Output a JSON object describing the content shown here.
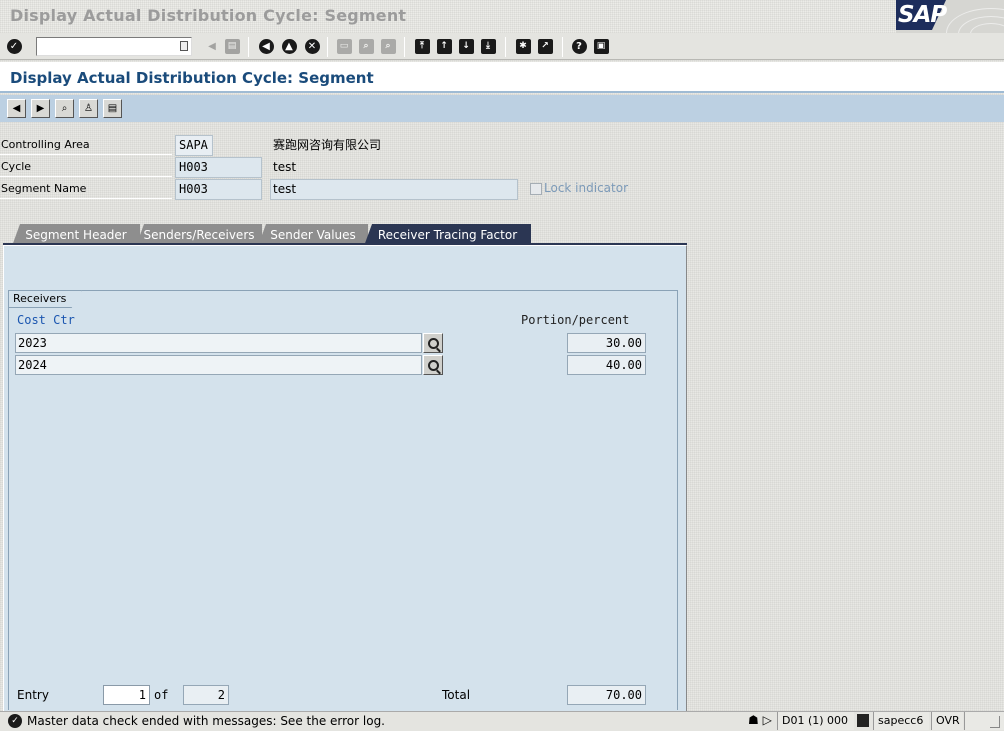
{
  "window": {
    "title": "Display Actual Distribution Cycle: Segment",
    "logo_text": "SAP"
  },
  "toolbar": {
    "command_field_value": "",
    "buttons": [
      {
        "name": "enter-icon",
        "glyph": "✓"
      },
      {
        "name": "back-arrow-icon",
        "glyph": "◀"
      },
      {
        "name": "save-icon",
        "glyph": "▤"
      },
      {
        "name": "back-icon",
        "glyph": "◀"
      },
      {
        "name": "exit-icon",
        "glyph": "▲"
      },
      {
        "name": "cancel-icon",
        "glyph": "✕"
      },
      {
        "name": "print-icon",
        "glyph": "▭"
      },
      {
        "name": "find-icon",
        "glyph": "⌕"
      },
      {
        "name": "find-next-icon",
        "glyph": "⌕"
      },
      {
        "name": "first-page-icon",
        "glyph": "⤒"
      },
      {
        "name": "previous-page-icon",
        "glyph": "↑"
      },
      {
        "name": "next-page-icon",
        "glyph": "↓"
      },
      {
        "name": "last-page-icon",
        "glyph": "⤓"
      },
      {
        "name": "new-session-icon",
        "glyph": "✱"
      },
      {
        "name": "shortcut-icon",
        "glyph": "↗"
      },
      {
        "name": "help-icon",
        "glyph": "?"
      },
      {
        "name": "layout-menu-icon",
        "glyph": "▣"
      }
    ]
  },
  "screen": {
    "title": "Display Actual Distribution Cycle: Segment"
  },
  "app_toolbar": {
    "buttons": [
      {
        "name": "previous-segment-icon",
        "glyph": "◀"
      },
      {
        "name": "next-segment-icon",
        "glyph": "▶"
      },
      {
        "name": "binoculars-icon",
        "glyph": "⌕"
      },
      {
        "name": "user-icon",
        "glyph": "♙"
      },
      {
        "name": "print-preview-icon",
        "glyph": "▤"
      }
    ]
  },
  "header": {
    "controlling_area": {
      "label": "Controlling Area",
      "value": "SAPA",
      "text": "赛跑网咨询有限公司"
    },
    "cycle": {
      "label": "Cycle",
      "value": "H003",
      "text": "test"
    },
    "segment": {
      "label": "Segment Name",
      "value": "H003",
      "text": "test"
    },
    "lock_indicator": {
      "label": "Lock indicator",
      "checked": false
    }
  },
  "tabs": [
    {
      "label": "Segment Header",
      "active": false
    },
    {
      "label": "Senders/Receivers",
      "active": false
    },
    {
      "label": "Sender Values",
      "active": false
    },
    {
      "label": "Receiver Tracing Factor",
      "active": true
    }
  ],
  "receivers": {
    "group_title": "Receivers",
    "col_cost_ctr": "Cost Ctr",
    "col_portion": "Portion/percent",
    "rows": [
      {
        "cost_ctr": "2023",
        "portion": "30.00"
      },
      {
        "cost_ctr": "2024",
        "portion": "40.00"
      }
    ],
    "entry_label": "Entry",
    "entry_value": "1",
    "of_label": "of",
    "of_value": "2",
    "total_label": "Total",
    "total_value": "70.00"
  },
  "status": {
    "message": "Master data check ended with messages: See the error log.",
    "system": "D01 (1) 000",
    "server": "sapecc6",
    "mode": "OVR"
  }
}
